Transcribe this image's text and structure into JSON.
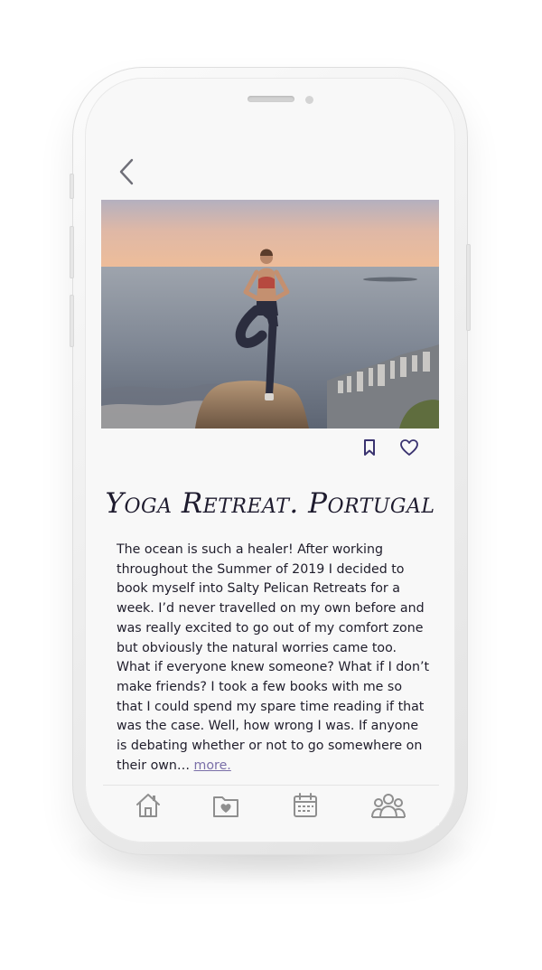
{
  "post": {
    "title": "Yoga Retreat. Portugal",
    "body": "The ocean is such a healer! After working throughout the Summer of 2019 I decided to book myself into Salty Pelican Retreats for a week. I’d never travelled on my own before and was really excited to go out of my comfort zone but obviously the natural worries came too. What if everyone knew someone? What if I don’t make friends? I took a few books with me so that I could spend my spare time reading if that was the case. Well, how wrong I was. If anyone is debating whether or not to go somewhere on their own…",
    "more_label": "more."
  },
  "icons": {
    "back": "chevron-left-icon",
    "bookmark": "bookmark-icon",
    "favorite": "heart-icon",
    "tabs": [
      "home-icon",
      "folder-heart-icon",
      "calendar-icon",
      "community-icon"
    ]
  },
  "colors": {
    "accent": "#3a3370",
    "text": "#1f1d2b",
    "link": "#7a6fa8",
    "tab_icon": "#8f8f8f"
  }
}
